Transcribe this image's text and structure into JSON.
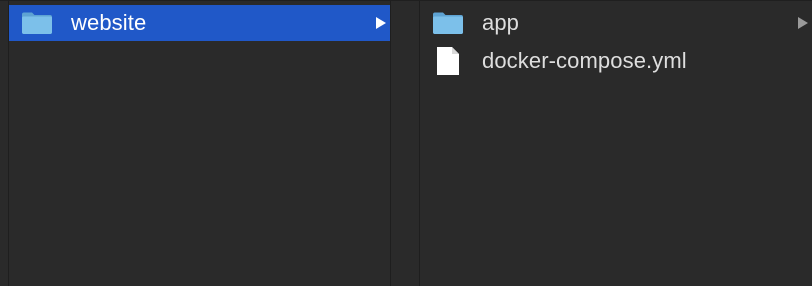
{
  "columns": [
    {
      "items": [
        {
          "label": "website",
          "kind": "folder",
          "selected": true,
          "has_children": true
        }
      ]
    },
    {
      "items": [
        {
          "label": "app",
          "kind": "folder",
          "selected": false,
          "has_children": true
        },
        {
          "label": "docker-compose.yml",
          "kind": "file",
          "selected": false,
          "has_children": false
        }
      ]
    }
  ],
  "colors": {
    "background": "#2a2a2a",
    "selection": "#2058c8",
    "folder": "#6fb4e0",
    "text": "#dedede"
  }
}
